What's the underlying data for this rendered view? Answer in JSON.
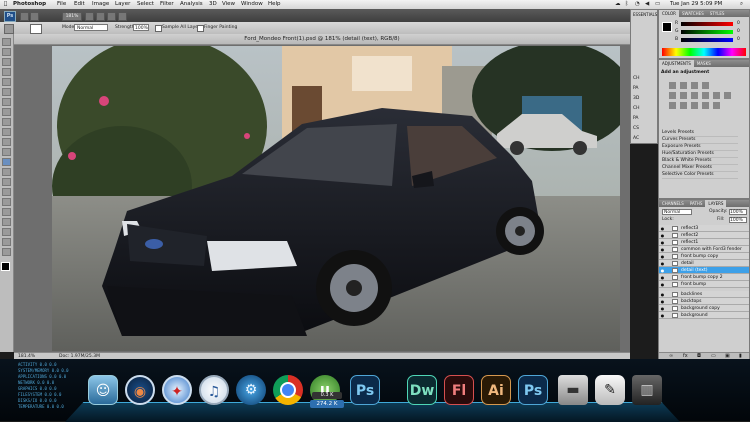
{
  "menubar": {
    "apple": "",
    "app": "Photoshop",
    "items": [
      "File",
      "Edit",
      "Image",
      "Layer",
      "Select",
      "Filter",
      "Analysis",
      "3D",
      "View",
      "Window",
      "Help"
    ],
    "clock": "Tue Jan 29  5:09 PM"
  },
  "appbar": {
    "zoom": "181%",
    "workspace": "ESSENTIALS"
  },
  "options": {
    "mode_label": "Mode:",
    "mode_value": "Normal",
    "strength_label": "Strength:",
    "strength_value": "100%",
    "sample_all": "Sample All Layers",
    "finger": "Finger Painting"
  },
  "document": {
    "title": "Ford_Mondeo Front(1).psd @ 181% (detail (text), RGB/8)",
    "status_zoom": "181.4%",
    "status_doc": "Doc: 1.97M/25.3M"
  },
  "panels": {
    "color_tabs": [
      "COLOR",
      "SWATCHES",
      "STYLES"
    ],
    "color_channels": [
      "R",
      "G",
      "B"
    ],
    "color_values": [
      "0",
      "0",
      "0"
    ],
    "adjust_tabs": [
      "ADJUSTMENTS",
      "MASKS"
    ],
    "adjust_title": "Add an adjustment",
    "presets": [
      "Levels Presets",
      "Curves Presets",
      "Exposure Presets",
      "Hue/Saturation Presets",
      "Black & White Presets",
      "Channel Mixer Presets",
      "Selective Color Presets"
    ],
    "layers_tabs": [
      "CHANNELS",
      "PATHS",
      "LAYERS"
    ],
    "blend_mode": "Normal",
    "opacity_label": "Opacity:",
    "opacity_value": "100%",
    "lock_label": "Lock:",
    "fill_label": "Fill:",
    "fill_value": "100%",
    "layers": [
      "reflect3",
      "reflect2",
      "reflect1",
      "common with Ford3 fender",
      "front bump copy",
      "detail",
      "detail (text)",
      "front bump copy 2",
      "front bump",
      "backlines",
      "backtops",
      "background copy",
      "background"
    ],
    "selected_layer": "detail (text)",
    "mini_panel_labels": [
      "CH",
      "PA",
      "3D",
      "CH",
      "PA",
      "CS",
      "AC"
    ]
  },
  "dock": {
    "apps": [
      "Finder",
      "Camino",
      "Safari",
      "iTunes",
      "Activity",
      "Chrome",
      "uTorrent",
      "Ps",
      "Dw",
      "Fl",
      "Ai",
      "Ps",
      "Drive",
      "Preview",
      "Trash"
    ],
    "ut_up": "0.3 K",
    "ut_down": "274.2 K"
  },
  "sysmon": [
    "ACTIVITY    0.0  0.0",
    "SYSTEM/MEMORY  0.0  0.0",
    "APPLICATIONS   0.0  0.0",
    "NETWORK    0.0  0.0",
    "GRAPHICS   0.0  0.0",
    "FILESYSTEM 0.0  0.0",
    "DISKS/IO   0.0  0.0",
    "TEMPERATURE  0.0  0.0"
  ]
}
